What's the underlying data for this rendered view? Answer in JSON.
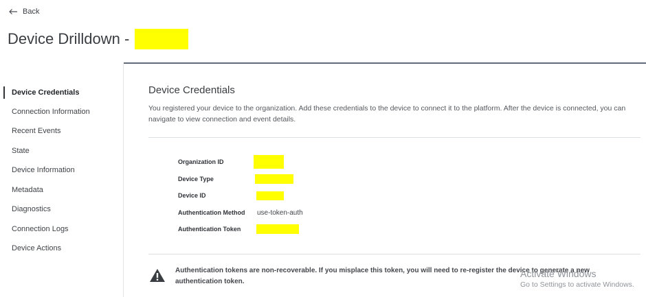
{
  "header": {
    "back_label": "Back",
    "page_title": "Device Drilldown -",
    "redaction_color": "#ffff00"
  },
  "sidebar": {
    "active_index": 0,
    "items": [
      {
        "label": "Device Credentials"
      },
      {
        "label": "Connection Information"
      },
      {
        "label": "Recent Events"
      },
      {
        "label": "State"
      },
      {
        "label": "Device Information"
      },
      {
        "label": "Metadata"
      },
      {
        "label": "Diagnostics"
      },
      {
        "label": "Connection Logs"
      },
      {
        "label": "Device Actions"
      }
    ]
  },
  "main": {
    "section_title": "Device Credentials",
    "description": "You registered your device to the organization. Add these credentials to the device to connect it to the platform. After the device is connected, you can navigate to view connection and event details.",
    "credentials": [
      {
        "label": "Organization ID",
        "value": "",
        "redacted": true
      },
      {
        "label": "Device Type",
        "value": "",
        "redacted": true
      },
      {
        "label": "Device ID",
        "value": "",
        "redacted": true
      },
      {
        "label": "Authentication Method",
        "value": "use-token-auth",
        "redacted": false
      },
      {
        "label": "Authentication Token",
        "value": "",
        "redacted": true
      }
    ],
    "warning": {
      "icon": "warning-triangle-icon",
      "text": "Authentication tokens are non-recoverable. If you misplace this token, you will need to re-register the device to generate a new authentication token."
    }
  },
  "watermark": {
    "title": "Activate Windows",
    "subtitle": "Go to Settings to activate Windows."
  }
}
